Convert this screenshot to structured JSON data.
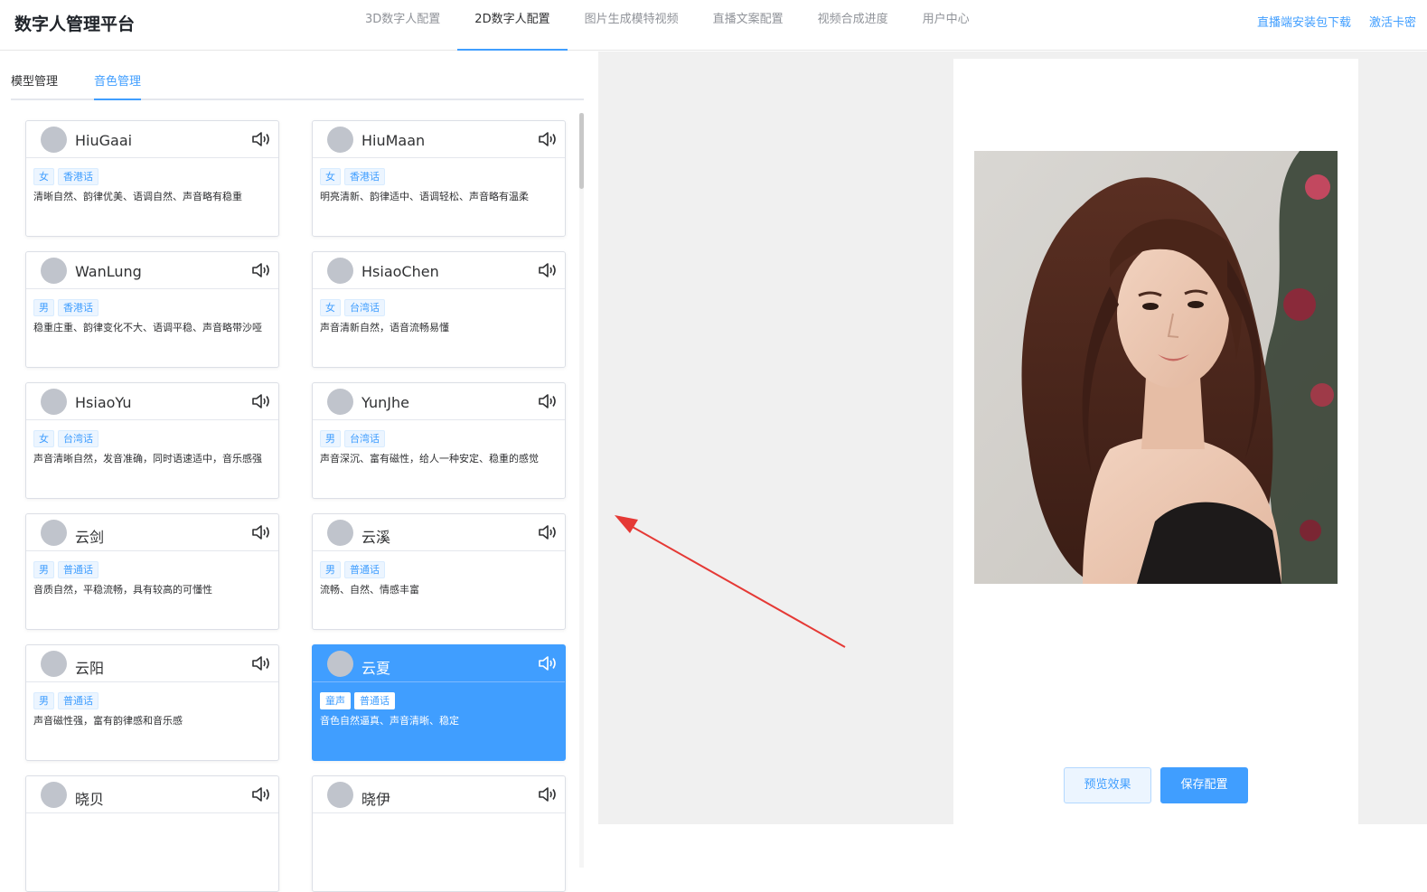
{
  "header": {
    "brand": "数字人管理平台",
    "nav": [
      {
        "label": "3D数字人配置",
        "active": false
      },
      {
        "label": "2D数字人配置",
        "active": true
      },
      {
        "label": "图片生成模特视频",
        "active": false
      },
      {
        "label": "直播文案配置",
        "active": false
      },
      {
        "label": "视频合成进度",
        "active": false
      },
      {
        "label": "用户中心",
        "active": false
      }
    ],
    "links": [
      "直播端安装包下载",
      "激活卡密"
    ]
  },
  "tabs": [
    {
      "label": "模型管理",
      "active": false
    },
    {
      "label": "音色管理",
      "active": true
    }
  ],
  "voices": [
    {
      "name": "HiuGaai",
      "tags": [
        "女",
        "香港话"
      ],
      "desc": "清晰自然、韵律优美、语调自然、声音略有稳重",
      "selected": false
    },
    {
      "name": "HiuMaan",
      "tags": [
        "女",
        "香港话"
      ],
      "desc": "明亮清新、韵律适中、语调轻松、声音略有温柔",
      "selected": false
    },
    {
      "name": "WanLung",
      "tags": [
        "男",
        "香港话"
      ],
      "desc": "稳重庄重、韵律变化不大、语调平稳、声音略带沙哑",
      "selected": false
    },
    {
      "name": "HsiaoChen",
      "tags": [
        "女",
        "台湾话"
      ],
      "desc": "声音清新自然，语音流畅易懂",
      "selected": false
    },
    {
      "name": "HsiaoYu",
      "tags": [
        "女",
        "台湾话"
      ],
      "desc": "声音清晰自然，发音准确，同时语速适中，音乐感强",
      "selected": false
    },
    {
      "name": "YunJhe",
      "tags": [
        "男",
        "台湾话"
      ],
      "desc": "声音深沉、富有磁性，给人一种安定、稳重的感觉",
      "selected": false
    },
    {
      "name": "云剑",
      "tags": [
        "男",
        "普通话"
      ],
      "desc": "音质自然，平稳流畅，具有较高的可懂性",
      "selected": false
    },
    {
      "name": "云溪",
      "tags": [
        "男",
        "普通话"
      ],
      "desc": "流畅、自然、情感丰富",
      "selected": false
    },
    {
      "name": "云阳",
      "tags": [
        "男",
        "普通话"
      ],
      "desc": "声音磁性强，富有韵律感和音乐感",
      "selected": false
    },
    {
      "name": "云夏",
      "tags": [
        "童声",
        "普通话"
      ],
      "desc": "音色自然逼真、声音清晰、稳定",
      "selected": true
    },
    {
      "name": "晓贝",
      "tags": [],
      "desc": "",
      "selected": false
    },
    {
      "name": "晓伊",
      "tags": [],
      "desc": "",
      "selected": false
    }
  ],
  "buttons": {
    "preview": "预览效果",
    "save": "保存配置"
  },
  "colors": {
    "accent": "#409eff",
    "selected_card": "#409eff",
    "annotation_arrow": "#e53935",
    "right_bg": "#f0f0f0"
  },
  "icons": {
    "speaker": "speaker-icon",
    "avatar": "avatar"
  }
}
